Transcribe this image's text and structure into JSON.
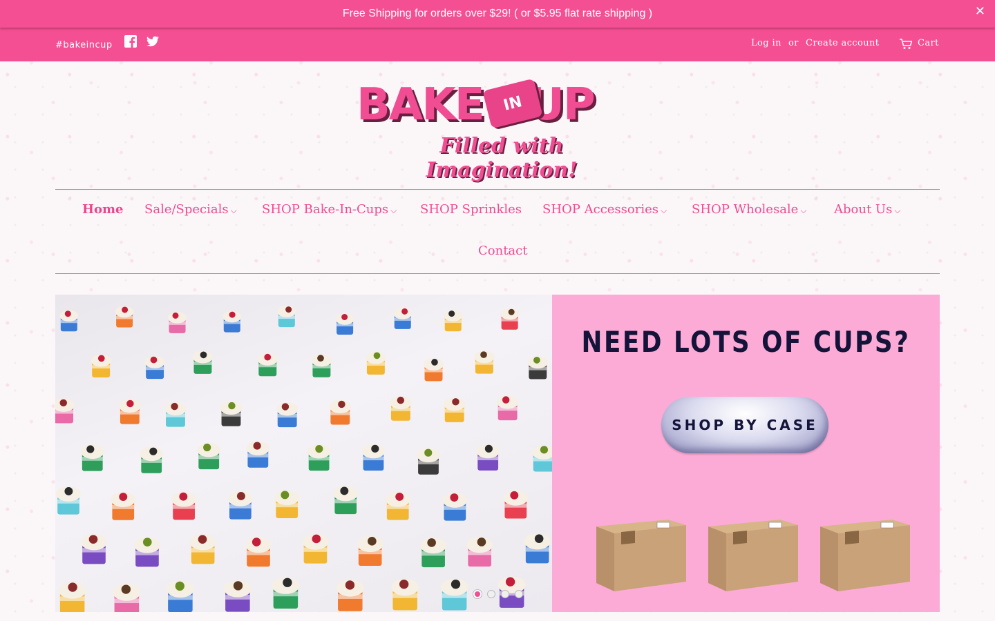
{
  "announcement": {
    "text": "Free Shipping for orders over $29! ( or $5.95 flat rate shipping )",
    "close": "✕"
  },
  "topbar": {
    "hashtag": "#bakeincup",
    "login": "Log in",
    "or": "or",
    "create_account": "Create account",
    "cart": "Cart"
  },
  "logo": {
    "text": "BAKE  CUP",
    "badge": "IN",
    "tagline": "Filled with Imagination!"
  },
  "nav": {
    "items": [
      {
        "label": "Home",
        "active": true
      },
      {
        "label": "Sale/Specials"
      },
      {
        "label": "SHOP Bake-In-Cups"
      },
      {
        "label": "SHOP Sprinkles"
      },
      {
        "label": "SHOP Accessories"
      },
      {
        "label": "SHOP Wholesale"
      },
      {
        "label": "About Us"
      },
      {
        "label": "Contact"
      }
    ],
    "caret": "⌵"
  },
  "hero": {
    "headline": "NEED LOTS OF CUPS?",
    "button": "SHOP BY CASE",
    "slides": 4,
    "active_slide": 1
  },
  "colors": {
    "brand_pink": "#f44f92",
    "promo_bg": "#fcabd6",
    "navy": "#14143a"
  }
}
